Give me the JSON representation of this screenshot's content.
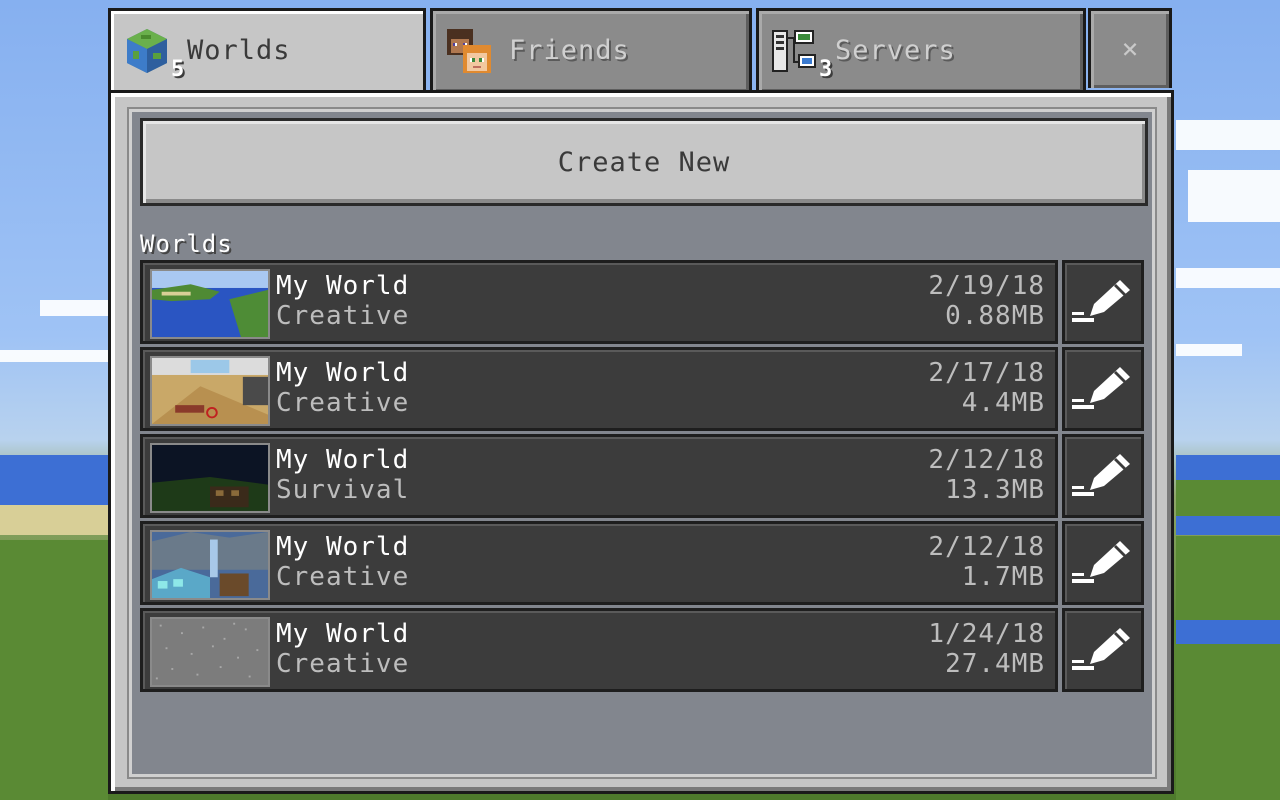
{
  "tabs": [
    {
      "label": "Worlds",
      "badge": "5",
      "icon": "globe-icon",
      "active": true
    },
    {
      "label": "Friends",
      "badge": "",
      "icon": "friends-icon",
      "active": false
    },
    {
      "label": "Servers",
      "badge": "3",
      "icon": "servers-icon",
      "active": false
    }
  ],
  "close_label": "×",
  "create_button": "Create New",
  "section_label": "Worlds",
  "worlds": [
    {
      "name": "My World",
      "mode": "Creative",
      "date": "2/19/18",
      "size": "0.88MB",
      "thumb": "ocean-island"
    },
    {
      "name": "My World",
      "mode": "Creative",
      "date": "2/17/18",
      "size": "4.4MB",
      "thumb": "wooden-room"
    },
    {
      "name": "My World",
      "mode": "Survival",
      "date": "2/12/18",
      "size": "13.3MB",
      "thumb": "night-field"
    },
    {
      "name": "My World",
      "mode": "Creative",
      "date": "2/12/18",
      "size": "1.7MB",
      "thumb": "diamond-build"
    },
    {
      "name": "My World",
      "mode": "Creative",
      "date": "1/24/18",
      "size": "27.4MB",
      "thumb": "gray-static"
    }
  ],
  "colors": {
    "panel": "#c6c6c6",
    "row": "#3c3c3c",
    "text_white": "#ffffff",
    "text_gray": "#bdbdbd"
  }
}
